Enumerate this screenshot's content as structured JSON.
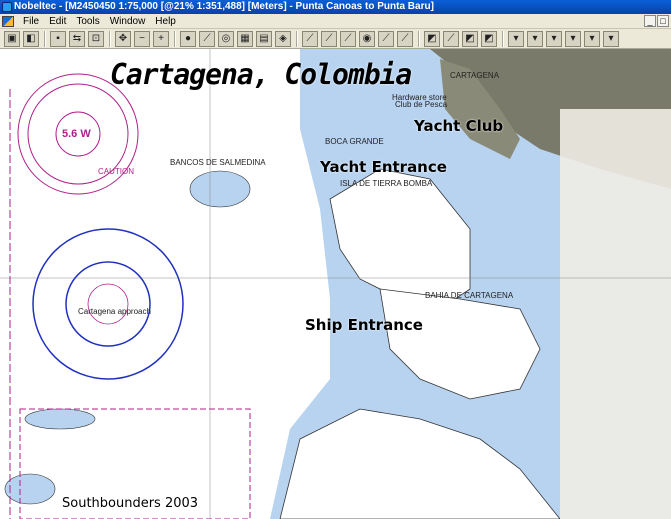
{
  "window": {
    "title": "Nobeltec - [M2450450 1:75,000 [@21% 1:351,488] [Meters] - Punta Canoas to Punta Baru]"
  },
  "menu": [
    "File",
    "Edit",
    "Tools",
    "Window",
    "Help"
  ],
  "toolbar": {
    "buttons": [
      "vessel",
      "chart",
      "waypoint",
      "route",
      "target",
      "zoom-out",
      "zoom-in",
      "pan",
      "mark",
      "center",
      "grid",
      "print",
      "layer-1",
      "layer-2",
      "layer-3",
      "layer-4",
      "layer-5",
      "layer-6",
      "layer-7",
      "layer-8",
      "tool-1",
      "tool-2",
      "tool-3",
      "tool-4",
      "tool-5",
      "tool-6"
    ]
  },
  "overlays": {
    "title": "Cartagena, Colombia",
    "yacht_club": "Yacht Club",
    "yacht_entrance": "Yacht Entrance",
    "ship_entrance": "Ship Entrance",
    "credit": "Southbounders 2003"
  },
  "chart_labels": {
    "magvar": "5.6 W",
    "bancos": "BANCOS DE SALMEDINA",
    "boca_grande": "BOCA GRANDE",
    "isla_tierra_bomba": "ISLA DE TIERRA BOMBA",
    "bahia": "BAHIA DE CARTAGENA",
    "approach": "Cartagena approach",
    "caution": "CAUTION",
    "club": "Club de Pesca",
    "hardware": "Hardware store",
    "cartagena": "CARTAGENA"
  },
  "colors": {
    "land": "#7a7a6a",
    "shallow": "#b7d3f0",
    "deep": "#ffffff",
    "magenta": "#b0208a",
    "circle": "#2030c0"
  }
}
